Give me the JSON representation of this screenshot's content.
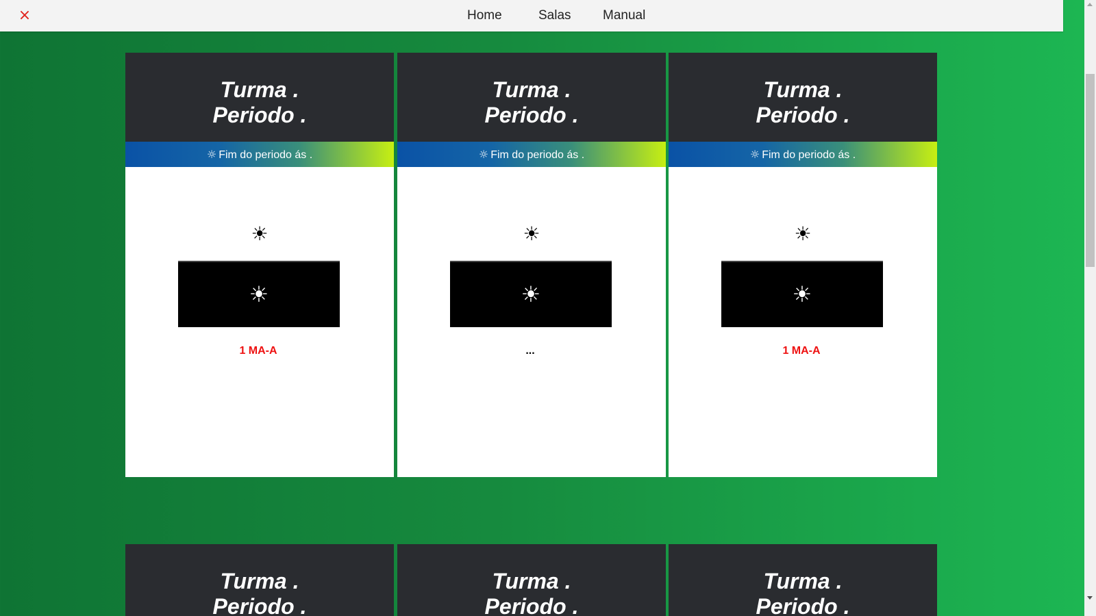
{
  "topbar": {
    "close_symbol": "×",
    "nav": [
      {
        "label": "Home"
      },
      {
        "label": "Salas"
      },
      {
        "label": "Manual"
      }
    ]
  },
  "colors": {
    "background_start": "#0f7434",
    "background_end": "#1db753",
    "card_header": "#2a2c30",
    "band_start": "#0a52a6",
    "band_end": "#c7ef12",
    "label_red": "#ee1111"
  },
  "cards": [
    {
      "title_line1": "Turma .",
      "title_line2": "Periodo .",
      "band_icon": "☼",
      "band_text": "Fim do periodo ás .",
      "sun_icon": "☀",
      "box_icon": "☀",
      "label": "1 MA-A"
    },
    {
      "title_line1": "Turma .",
      "title_line2": "Periodo .",
      "band_icon": "☼",
      "band_text": "Fim do periodo ás .",
      "sun_icon": "☀",
      "box_icon": "☀",
      "label": "..."
    },
    {
      "title_line1": "Turma .",
      "title_line2": "Periodo .",
      "band_icon": "☼",
      "band_text": "Fim do periodo ás .",
      "sun_icon": "☀",
      "box_icon": "☀",
      "label": "1 MA-A"
    },
    {
      "title_line1": "Turma .",
      "title_line2": "Periodo ."
    },
    {
      "title_line1": "Turma .",
      "title_line2": "Periodo ."
    },
    {
      "title_line1": "Turma .",
      "title_line2": "Periodo ."
    }
  ]
}
